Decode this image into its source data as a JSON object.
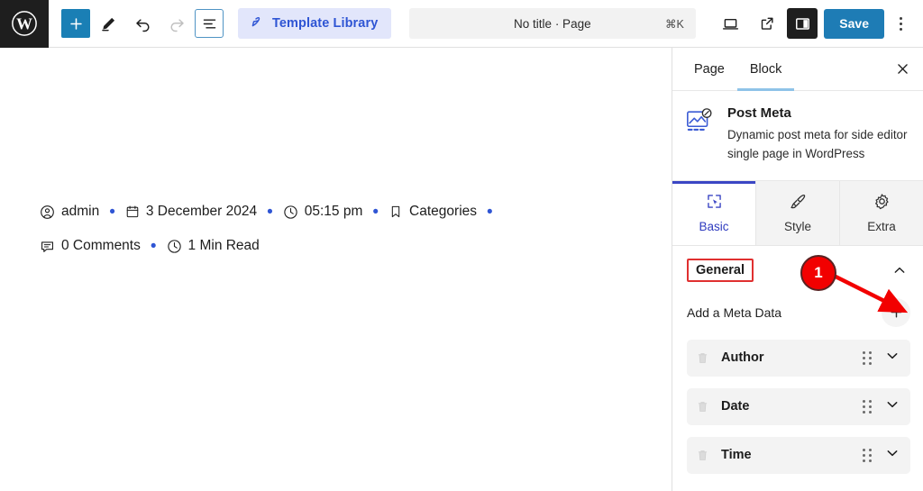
{
  "app": {
    "logo_icon": "wordpress-logo-icon"
  },
  "toolbar": {
    "add_block_icon": "plus-icon",
    "edit_icon": "pencil-icon",
    "undo_icon": "undo-arrow-icon",
    "redo_icon": "redo-arrow-icon",
    "list_view_icon": "document-outline-icon",
    "template_library_label": "Template Library",
    "template_library_icon": "template-brush-icon",
    "template_library_bg": "#e2e6fb",
    "template_library_color": "#2f55d4",
    "command_bar": {
      "title": "No title · Page",
      "shortcut": "⌘K"
    },
    "view_icon": "laptop-view-icon",
    "preview_icon": "external-link-icon",
    "sidebar_toggle_icon": "panel-layout-icon",
    "save_label": "Save",
    "save_bg": "#1e7cb5",
    "options_icon": "kebab-menu-icon",
    "accent_blue": "#1a7fb5"
  },
  "canvas": {
    "meta_line_1": [
      {
        "icon": "user-circle-icon",
        "text": "admin"
      },
      {
        "icon": "calendar-icon",
        "text": "3 December 2024"
      },
      {
        "icon": "clock-icon",
        "text": "05:15 pm"
      },
      {
        "icon": "bookmark-icon",
        "text": "Categories"
      }
    ],
    "meta_line_2": [
      {
        "icon": "comment-icon",
        "text": "0 Comments"
      },
      {
        "icon": "clock-icon",
        "text": "1 Min Read"
      }
    ],
    "separator": "•",
    "separator_color": "#2f55d4",
    "trailing_separator": true
  },
  "sidebar": {
    "tabs": [
      {
        "label": "Page",
        "active": false
      },
      {
        "label": "Block",
        "active": true
      }
    ],
    "close_icon": "close-icon",
    "block": {
      "icon": "post-meta-image-icon",
      "title": "Post Meta",
      "description": "Dynamic post meta for side editor single page in WordPress"
    },
    "subtabs": [
      {
        "label": "Basic",
        "icon": "cursor-select-icon",
        "active": true
      },
      {
        "label": "Style",
        "icon": "paintbrush-icon",
        "active": false
      },
      {
        "label": "Extra",
        "icon": "gear-icon",
        "active": false
      }
    ],
    "general": {
      "label": "General",
      "collapse_icon": "chevron-up-icon",
      "highlight_color": "#e03030"
    },
    "add_meta": {
      "label": "Add a Meta Data",
      "add_icon": "plus-icon"
    },
    "meta_items": [
      {
        "label": "Author",
        "delete_icon": "trash-icon",
        "drag_icon": "drag-handle-icon",
        "expand_icon": "chevron-down-icon"
      },
      {
        "label": "Date",
        "delete_icon": "trash-icon",
        "drag_icon": "drag-handle-icon",
        "expand_icon": "chevron-down-icon"
      },
      {
        "label": "Time",
        "delete_icon": "trash-icon",
        "drag_icon": "drag-handle-icon",
        "expand_icon": "chevron-down-icon"
      }
    ]
  },
  "annotation": {
    "step_number": "1",
    "color": "#f20000"
  }
}
